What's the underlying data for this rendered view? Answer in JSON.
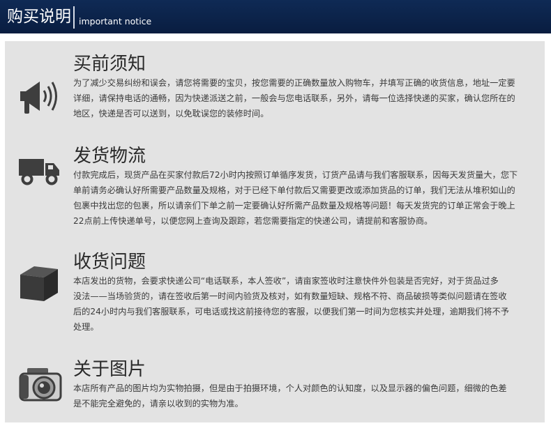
{
  "header": {
    "title": "购买说明",
    "subtitle": "important notice"
  },
  "sections": [
    {
      "title": "买前须知",
      "icon": "megaphone-icon",
      "body": "为了减少交易纠纷和误会，请您将需要的宝贝，按您需要的正确数量放入购物车，并填写正确的收货信息，地址一定要\n详细，请保持电话的通畅，因为快递派送之前，一般会与您电话联系，另外，请每一位选择快递的买家，确认您所在的\n地区，快递是否可以送到，以免耽误您的装修时间。"
    },
    {
      "title": "发货物流",
      "icon": "truck-icon",
      "body": "付款完成后，现货产品在买家付款后72小时内按照订单循序发货，订货产品请与我们客服联系，因每天发货量大，您下\n单前请务必确认好所需要产品数量及规格，对于已经下单付款后又需要更改或添加货品的订单，我们无法从堆积如山的\n包裹中找出您的包裹，所以请亲们下单之前一定要确认好所需产品数量及规格等问题！每天发货完的订单正常会于晚上\n22点前上传快递单号，以便您网上查询及跟踪，若您需要指定的快递公司，请提前和客服协商。"
    },
    {
      "title": "收货问题",
      "icon": "package-box-icon",
      "body": "本店发出的货物，会要求快递公司“电话联系，本人签收”，请亩家签收时注意快件外包装是否完好，对于货品过多\n没法——当场验货的，请在签收后第一时间内验货及核对，如有数量短缺、规格不符、商品破损等类似问题请在签收\n后的24小时内与我们客服联系，可电话或找这前接待您的客服，以便我们第一时间为您核实并处理，逾期我们将不予\n处理。"
    },
    {
      "title": "关于图片",
      "icon": "camera-icon",
      "body": "本店所有产品的图片均为实物拍摄，但是由于拍摄环境，个人对颜色的认知度，以及显示器的偏色问题，细微的色差\n是不能完全避免的，请亲以收到的实物为准。"
    }
  ]
}
